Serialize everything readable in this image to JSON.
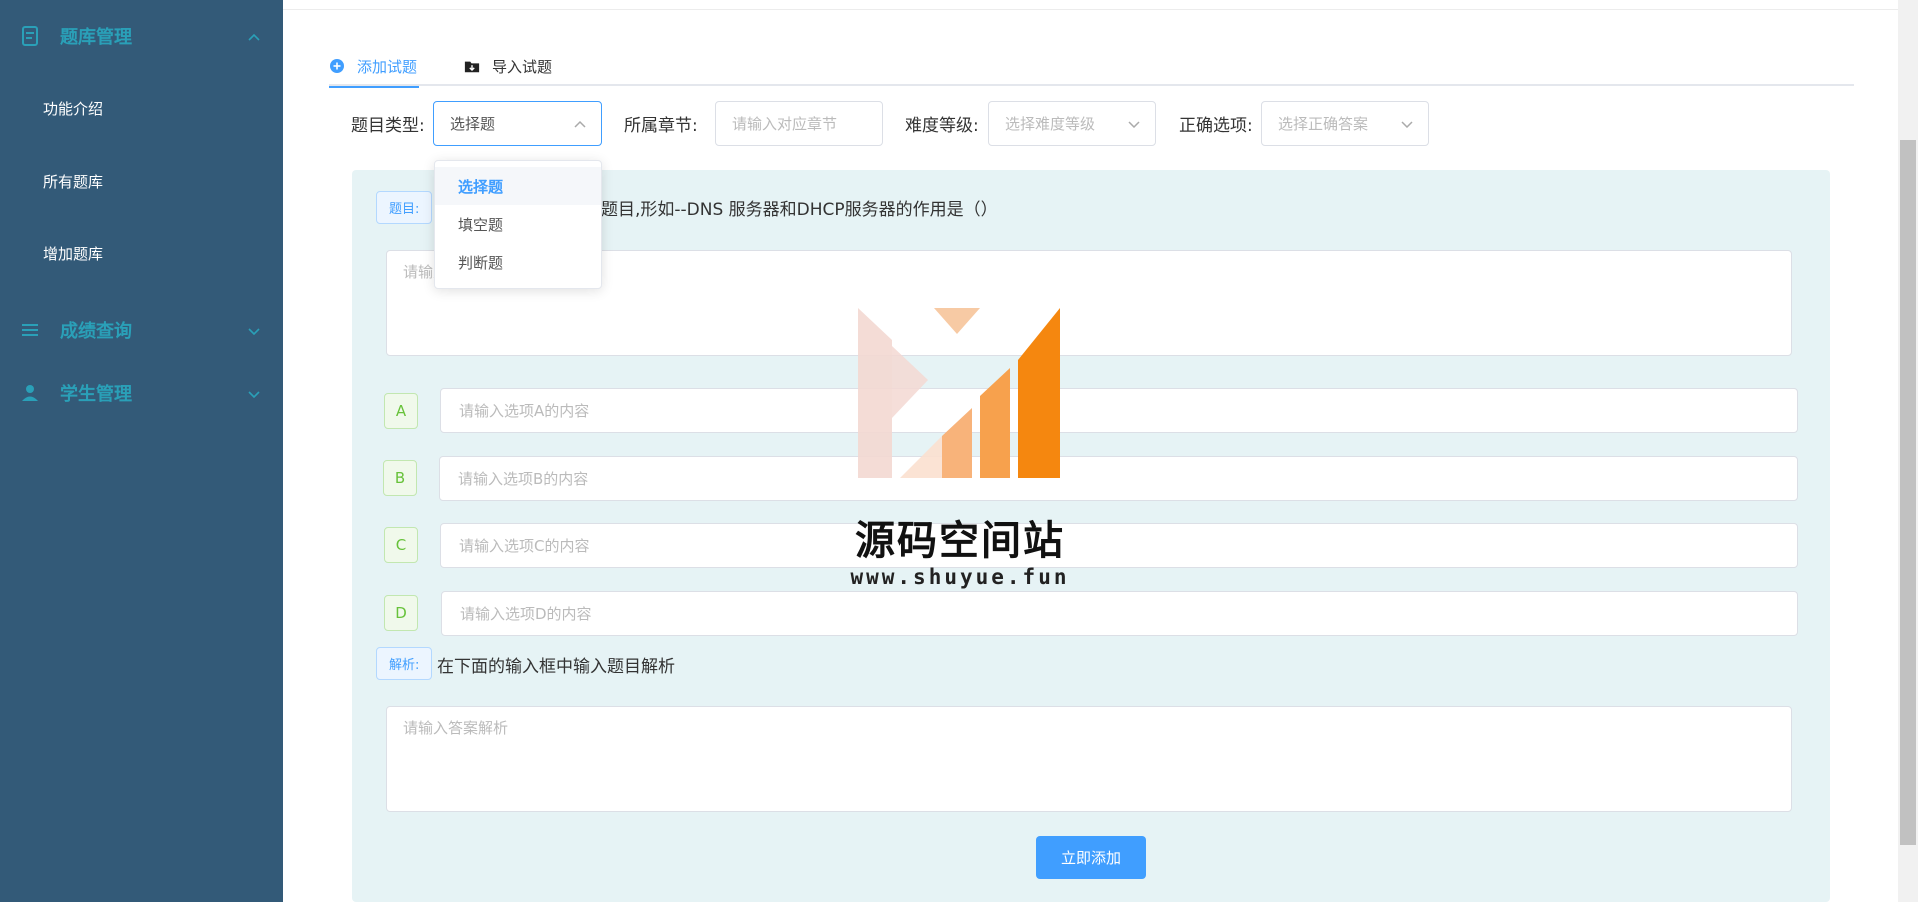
{
  "sidebar": {
    "groups": [
      {
        "label": "题库管理",
        "icon": "document-icon",
        "expanded": true
      },
      {
        "label": "成绩查询",
        "icon": "list-icon",
        "expanded": false
      },
      {
        "label": "学生管理",
        "icon": "user-icon",
        "expanded": false
      }
    ],
    "items": [
      {
        "label": "功能介绍"
      },
      {
        "label": "所有题库"
      },
      {
        "label": "增加题库"
      }
    ]
  },
  "tabs": [
    {
      "label": "添加试题",
      "icon": "plus-circle-icon",
      "active": true
    },
    {
      "label": "导入试题",
      "icon": "folder-download-icon",
      "active": false
    }
  ],
  "filters": {
    "type": {
      "label": "题目类型:",
      "value": "选择题"
    },
    "chapter": {
      "label": "所属章节:",
      "placeholder": "请输入对应章节"
    },
    "difficulty": {
      "label": "难度等级:",
      "placeholder": "选择难度等级"
    },
    "answer": {
      "label": "正确选项:",
      "placeholder": "选择正确答案"
    }
  },
  "dropdown": {
    "options": [
      "选择题",
      "填空题",
      "判断题"
    ],
    "selected_index": 0
  },
  "form": {
    "question_tag": "题目:",
    "question_hint": "入题目,形如--DNS 服务器和DHCP服务器的作用是（）",
    "question_placeholder": "请输入",
    "options": [
      {
        "letter": "A",
        "placeholder": "请输入选项A的内容"
      },
      {
        "letter": "B",
        "placeholder": "请输入选项B的内容"
      },
      {
        "letter": "C",
        "placeholder": "请输入选项C的内容"
      },
      {
        "letter": "D",
        "placeholder": "请输入选项D的内容"
      }
    ],
    "analysis_tag": "解析:",
    "analysis_hint": "在下面的输入框中输入题目解析",
    "analysis_placeholder": "请输入答案解析",
    "submit_label": "立即添加"
  },
  "watermark": {
    "title": "源码空间站",
    "url": "www.shuyue.fun"
  },
  "colors": {
    "sidebar_bg": "#335a78",
    "sidebar_accent": "#2aa0b8",
    "primary": "#409eff",
    "panel_bg": "#e6f3f5"
  }
}
